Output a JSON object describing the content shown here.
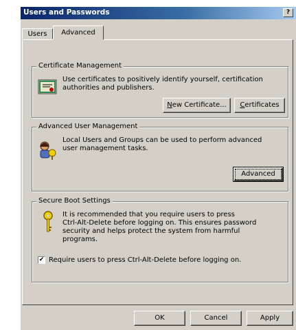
{
  "window": {
    "title": "Users and Passwords",
    "help_glyph": "?"
  },
  "tabs": [
    {
      "label": "Users"
    },
    {
      "label": "Advanced"
    }
  ],
  "cert_group": {
    "title": "Certificate Management",
    "line1": "Use certificates to positively identify yourself, certification",
    "line2": "authorities and publishers.",
    "new_cert_label": "New Certificate...",
    "new_cert_access": "N",
    "certificates_label": "Certificates",
    "certificates_access": "C"
  },
  "adv_group": {
    "title": "Advanced User Management",
    "line1": "Local Users and Groups can be used to perform advanced",
    "line2": "user management tasks.",
    "button_label": "Advanced"
  },
  "boot_group": {
    "title": "Secure Boot Settings",
    "lines": [
      "It is recommended that you require users to press",
      "Ctrl-Alt-Delete before logging on. This ensures password",
      "security and helps protect the system from harmful",
      "programs."
    ],
    "checkbox_label": "Require users to press Ctrl-Alt-Delete before logging on.",
    "checkbox_checked": true
  },
  "footer": {
    "ok": "OK",
    "cancel": "Cancel",
    "apply": "Apply"
  },
  "icons": {
    "cert": "certificate-icon",
    "users": "users-key-icon",
    "key": "key-icon"
  }
}
